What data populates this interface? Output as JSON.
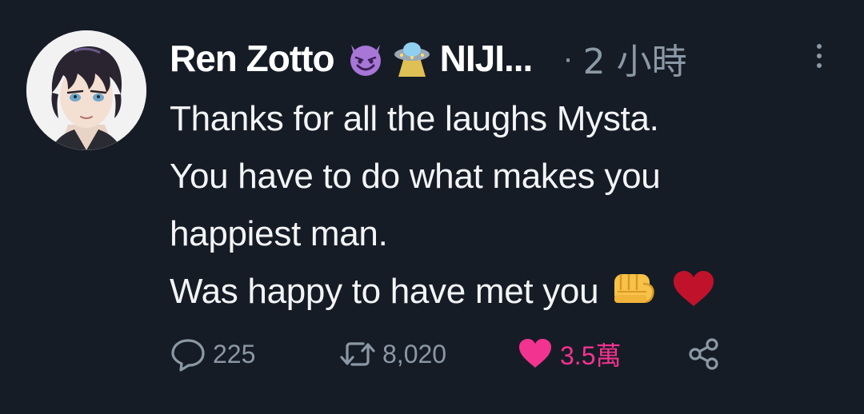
{
  "tweet": {
    "display_name": "Ren Zotto",
    "name_suffix": "NIJI...",
    "name_emojis": [
      "smiling-devil-icon",
      "ufo-icon"
    ],
    "time_separator": "·",
    "time": "2 小時",
    "text_lines": [
      "Thanks for all the laughs Mysta.",
      "You have to do what makes you",
      "happiest man.",
      "Was happy to have met you"
    ],
    "trailing_emojis": [
      "fist-icon",
      "heart-icon"
    ],
    "stats": {
      "replies": "225",
      "retweets": "8,020",
      "likes": "3.5萬"
    },
    "colors": {
      "background": "#161c26",
      "text": "#f3f4f6",
      "muted": "#8b98a5",
      "like_active": "#f2338f"
    }
  }
}
